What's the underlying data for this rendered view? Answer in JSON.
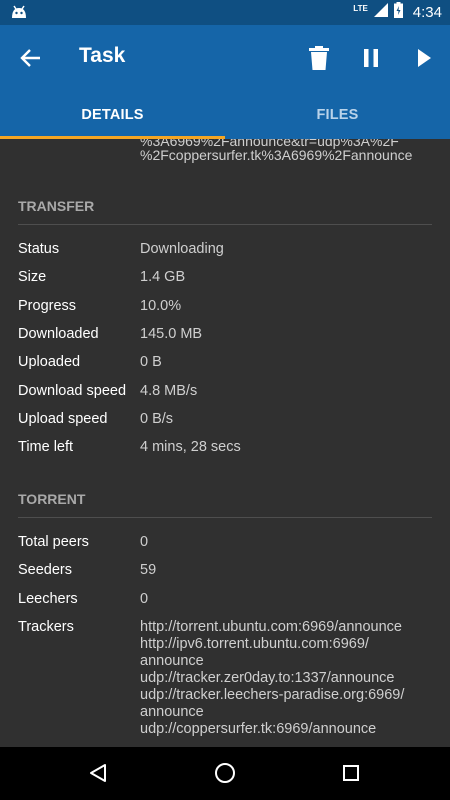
{
  "status_bar": {
    "network": "LTE",
    "time": "4:34",
    "icons": [
      "android-debug-icon",
      "signal-icon",
      "battery-charging-icon"
    ]
  },
  "app_bar": {
    "title": "Task",
    "icons": [
      "back-arrow-icon",
      "delete-icon",
      "pause-icon",
      "play-icon"
    ]
  },
  "tabs": [
    {
      "label": "DETAILS",
      "active": true
    },
    {
      "label": "FILES",
      "active": false
    }
  ],
  "partial_top_text": {
    "line1": "%3A6969%2Fannounce&tr=udp%3A%2F",
    "line2": "%2Fcoppersurfer.tk%3A6969%2Fannounce"
  },
  "transfer": {
    "heading": "TRANSFER",
    "rows": [
      {
        "label": "Status",
        "value": "Downloading"
      },
      {
        "label": "Size",
        "value": "1.4 GB"
      },
      {
        "label": "Progress",
        "value": "10.0%"
      },
      {
        "label": "Downloaded",
        "value": "145.0 MB"
      },
      {
        "label": "Uploaded",
        "value": "0 B"
      },
      {
        "label": "Download speed",
        "value": "4.8 MB/s"
      },
      {
        "label": "Upload speed",
        "value": "0 B/s"
      },
      {
        "label": "Time left",
        "value": "4 mins, 28 secs"
      }
    ]
  },
  "torrent": {
    "heading": "TORRENT",
    "rows": [
      {
        "label": "Total peers",
        "value": "0"
      },
      {
        "label": "Seeders",
        "value": "59"
      },
      {
        "label": "Leechers",
        "value": "0"
      }
    ],
    "trackers_label": "Trackers",
    "trackers_lines": [
      "http://torrent.ubuntu.com:6969/announce",
      "http://ipv6.torrent.ubuntu.com:6969/",
      "announce",
      "udp://tracker.zer0day.to:1337/announce",
      "udp://tracker.leechers-paradise.org:6969/",
      "announce",
      "udp://coppersurfer.tk:6969/announce"
    ]
  },
  "nav_bar": {
    "icons": [
      "back-triangle-icon",
      "home-circle-icon",
      "recents-square-icon"
    ]
  },
  "colors": {
    "status_bar": "#0f4f82",
    "app_bar": "#1565a8",
    "tab_indicator": "#f5a623",
    "background": "#303030"
  }
}
